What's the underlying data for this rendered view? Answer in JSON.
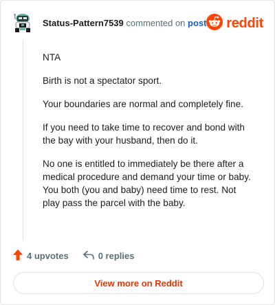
{
  "header": {
    "username": "Status-Pattern7539",
    "commented_text": "commented on",
    "post_link": "post",
    "brand": "reddit"
  },
  "comment": {
    "paragraphs": [
      "NTA",
      "Birth is not a spectator sport.",
      "Your boundaries are normal and completely fine.",
      "If you need to take time to recover and bond with the bay with your husband, then do it.",
      "No one is entitled to immediately be there after a medical procedure and demand your time or baby. You both (you and baby) need time to rest. Not play pass the parcel with the baby."
    ]
  },
  "actions": {
    "upvotes": "4 upvotes",
    "replies": "0 replies"
  },
  "footer": {
    "view_more": "View more on Reddit"
  },
  "colors": {
    "brand": "#ff4500",
    "link": "#1a5fb4",
    "view_more": "#d93a00"
  },
  "icons": {
    "upvote": "upvote-arrow-icon",
    "reply": "reply-arrow-icon",
    "brand": "reddit-logo-icon",
    "avatar": "snoo-avatar-icon"
  }
}
